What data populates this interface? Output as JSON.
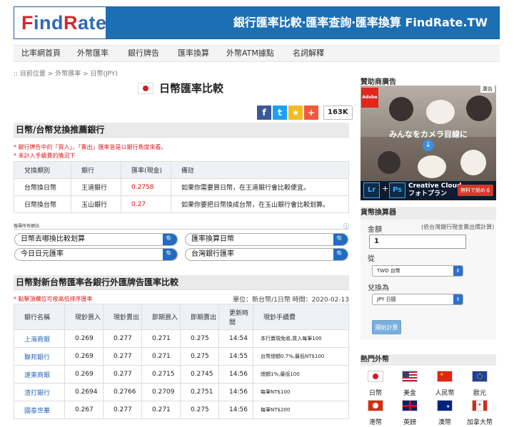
{
  "header": {
    "logo_f": "F",
    "logo_mid": "ind",
    "logo_r": "R",
    "logo_end": "ate",
    "tagline": "銀行匯率比較‧匯率查詢‧匯率換算 FindRate.TW"
  },
  "nav": [
    "比率網首頁",
    "外幣匯率",
    "銀行牌告",
    "匯率換算",
    "外幣ATM據點",
    "名詞解釋"
  ],
  "breadcrumb": ":: 目前位置 > 外幣匯率 > 日幣(JPY)",
  "page_title": "日幣匯率比較",
  "share": {
    "facebook": "f",
    "twitter": "t",
    "star": "★",
    "plus": "+",
    "count": "163K"
  },
  "recommend": {
    "title": "日幣/台幣兌換推薦銀行",
    "note1_prefix": "* 銀行牌告中的「買入」、「賣出」匯率皆是以銀行角度來看。",
    "note2": "* 未計入手續費的情況下",
    "headers": [
      "兌換類別",
      "銀行",
      "匯率(現金)",
      "備註"
    ],
    "rows": [
      {
        "type": "台幣換日幣",
        "bank": "王道銀行",
        "rate": "0.2758",
        "note": "如果你需要買日幣，在王道銀行會比較便宜。"
      },
      {
        "type": "日幣換台幣",
        "bank": "玉山銀行",
        "rate": "0.27",
        "note": "如果你要把日幣換成台幣，在玉山銀行會比較划算。"
      }
    ]
  },
  "search": {
    "head": "搜尋所有網站",
    "info": "ⓘ",
    "boxes": [
      "日幣去哪換比較划算",
      "匯率換算日幣",
      "今日日元匯率",
      "台灣銀行匯率"
    ],
    "go": "🔍"
  },
  "board": {
    "title": "日幣對新台幣匯率各銀行外匯牌告匯率比較",
    "note": "* 點擊頂欄位可按高低排序匯率",
    "meta": "單位：新台幣/1日幣 時間：2020-02-13",
    "headers": [
      "銀行名稱",
      "現鈔買入",
      "現鈔賣出",
      "即期買入",
      "即期賣出",
      "更新時間",
      "現鈔手續費"
    ],
    "rows": [
      [
        "上海商銀",
        "0.269",
        "0.277",
        "0.271",
        "0.275",
        "14:54",
        "本行賣現免收,買入每筆100"
      ],
      [
        "聯邦銀行",
        "0.269",
        "0.277",
        "0.271",
        "0.275",
        "14:55",
        "台幣總額0.7%,最低NT$100"
      ],
      [
        "遠東商銀",
        "0.269",
        "0.277",
        "0.2715",
        "0.2745",
        "14:56",
        "總額1%,最低100"
      ],
      [
        "渣打銀行",
        "0.2694",
        "0.2766",
        "0.2709",
        "0.2751",
        "14:56",
        "每筆NT$100"
      ],
      [
        "國泰世華",
        "0.267",
        "0.277",
        "0.271",
        "0.275",
        "14:56",
        "每筆NT$200"
      ]
    ]
  },
  "sponsor": {
    "label": "贊助商廣告",
    "ad_tag": "廣告",
    "brand": "Adobe",
    "caption": "みんなをカメラ目線に",
    "arrow": "↓",
    "lr": "Lr",
    "plus": "+",
    "ps": "Ps",
    "cc_line1": "Creative Cloud",
    "cc_line2": "フォトプラン",
    "cta": "無料で始める"
  },
  "converter": {
    "title": "貨幣換算器",
    "amount_label": "金額",
    "amount_sub": "(依台灣銀行現金賣出價計算)",
    "amount": "1",
    "from_label": "從",
    "from": "TWD 台幣",
    "to_label": "兌換為",
    "to": "JPY 日圓",
    "button": "開始計算",
    "caret": "⇕"
  },
  "hot": {
    "title": "熱門外幣",
    "flags": [
      {
        "name": "日幣",
        "code": "jp"
      },
      {
        "name": "美金",
        "code": "us"
      },
      {
        "name": "人民幣",
        "code": "cn"
      },
      {
        "name": "歐元",
        "code": "eu"
      },
      {
        "name": "港幣",
        "code": "hk"
      },
      {
        "name": "英鎊",
        "code": "gb"
      },
      {
        "name": "澳幣",
        "code": "au"
      },
      {
        "name": "加拿大幣",
        "code": "ca"
      }
    ]
  }
}
